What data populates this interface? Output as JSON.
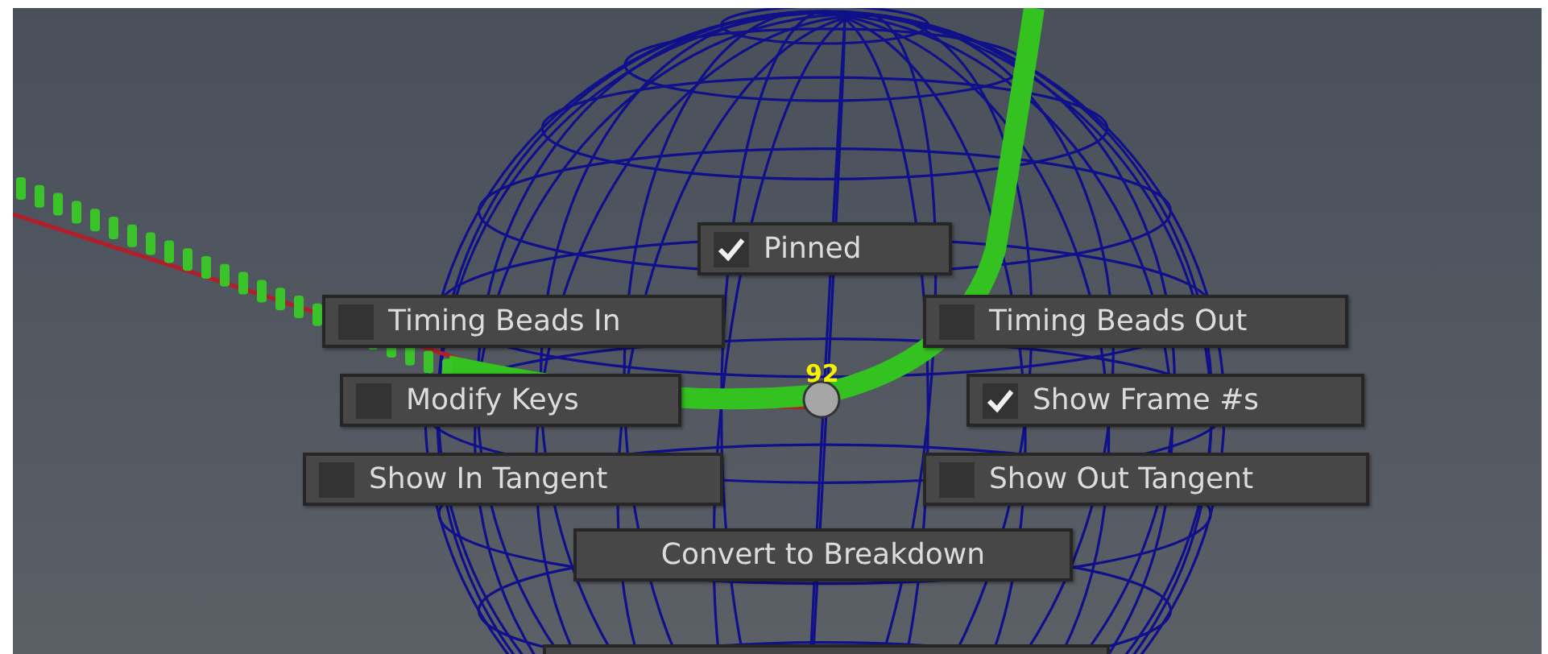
{
  "viewport": {
    "frame_label": "92",
    "menu_items": [
      {
        "label": "Pinned",
        "kind": "checkbox",
        "checked": true
      },
      {
        "label": "Timing Beads In",
        "kind": "checkbox",
        "checked": false
      },
      {
        "label": "Timing Beads Out",
        "kind": "checkbox",
        "checked": false
      },
      {
        "label": "Modify Keys",
        "kind": "checkbox",
        "checked": false
      },
      {
        "label": "Show Frame #s",
        "kind": "checkbox",
        "checked": true
      },
      {
        "label": "Show In Tangent",
        "kind": "checkbox",
        "checked": false
      },
      {
        "label": "Show Out Tangent",
        "kind": "checkbox",
        "checked": false
      },
      {
        "label": "Convert to Breakdown",
        "kind": "command"
      }
    ]
  }
}
